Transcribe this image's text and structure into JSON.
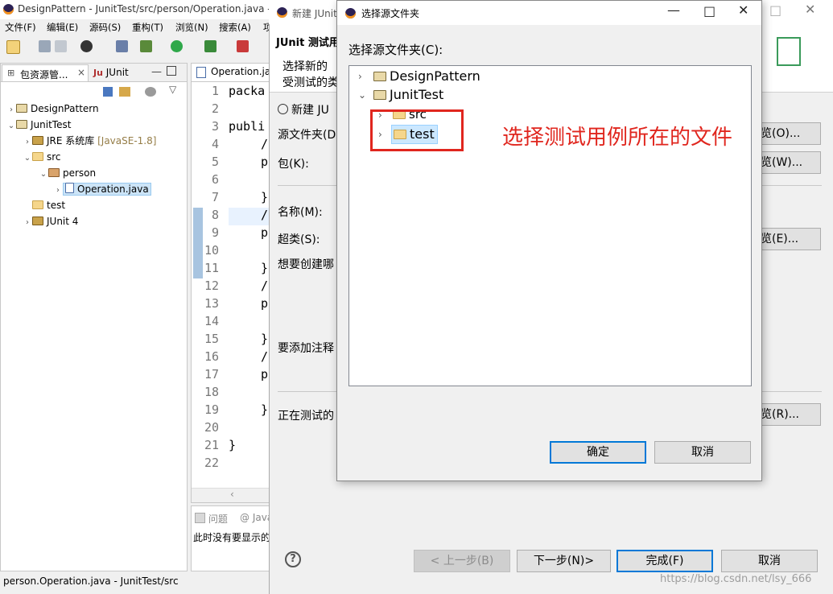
{
  "main_window": {
    "title": "DesignPattern - JunitTest/src/person/Operation.java - Ec",
    "menu": [
      "文件(F)",
      "编辑(E)",
      "源码(S)",
      "重构(T)",
      "浏览(N)",
      "搜索(A)",
      "项"
    ],
    "tabs": {
      "package_explorer": "包资源管...",
      "junit": "JUnit"
    },
    "tree": [
      {
        "label": "DesignPattern",
        "twisty": "›",
        "icon": "project-icon"
      },
      {
        "label": "JunitTest",
        "twisty": "⌄",
        "icon": "project-icon"
      },
      {
        "label": "JRE 系统库",
        "extra": "[JavaSE-1.8]",
        "twisty": "›",
        "icon": "library-icon"
      },
      {
        "label": "src",
        "twisty": "⌄",
        "icon": "source-folder-icon"
      },
      {
        "label": "person",
        "twisty": "⌄",
        "icon": "package-icon"
      },
      {
        "label": "Operation.java",
        "twisty": "›",
        "icon": "java-file-icon"
      },
      {
        "label": "test",
        "twisty": "",
        "icon": "source-folder-icon"
      },
      {
        "label": "JUnit 4",
        "twisty": "›",
        "icon": "library-icon"
      }
    ],
    "editor": {
      "tab": "Operation.java",
      "line_numbers": [
        "1",
        "2",
        "3",
        "4",
        "5",
        "6",
        "7",
        "8",
        "9",
        "10",
        "11",
        "12",
        "13",
        "14",
        "15",
        "16",
        "17",
        "18",
        "19",
        "20",
        "21",
        "22"
      ],
      "code": {
        "1": "packa",
        "3": "publi",
        "4": "/",
        "5": "p",
        "7": "}",
        "8": "/",
        "9": "p",
        "11": "}",
        "12": "/",
        "13": "p",
        "15": "}",
        "16": "/",
        "17": "p",
        "19": "}",
        "21": "}"
      }
    },
    "bottom_panel": {
      "tab_problems": "问题",
      "tab_javadoc": "@ Java",
      "message": "此时没有要显示的"
    },
    "status": "person.Operation.java - JunitTest/src"
  },
  "wizard": {
    "title": "新建 JUnit",
    "header_title": "JUnit 测试用",
    "header_desc_1": "选择新的",
    "header_desc_2": "受测试的类",
    "radio_new": "新建 JU",
    "source_folder_label": "源文件夹(D",
    "package_label": "包(K):",
    "name_label": "名称(M):",
    "superclass_label": "超类(S):",
    "stubs_label": "想要创建哪",
    "comments_label": "要添加注释",
    "class_under_test_label": "正在测试的",
    "browse_o": "览(O)...",
    "browse_w": "览(W)...",
    "browse_e": "览(E)...",
    "browse_r": "览(R)...",
    "back_button": "< 上一步(B)",
    "next_button": "下一步(N)>",
    "finish_button": "完成(F)",
    "cancel_button": "取消",
    "watermark": "https://blog.csdn.net/lsy_666"
  },
  "folder_dialog": {
    "title": "选择源文件夹",
    "prompt": "选择源文件夹(C):",
    "tree": [
      {
        "label": "DesignPattern",
        "twisty": "›"
      },
      {
        "label": "JunitTest",
        "twisty": "⌄"
      },
      {
        "label": "src",
        "twisty": "›"
      },
      {
        "label": "test",
        "twisty": "›",
        "selected": true
      }
    ],
    "ok_button": "确定",
    "cancel_button": "取消"
  },
  "annotation": {
    "text": "选择测试用例所在的文件",
    "color": "#e0261e"
  }
}
